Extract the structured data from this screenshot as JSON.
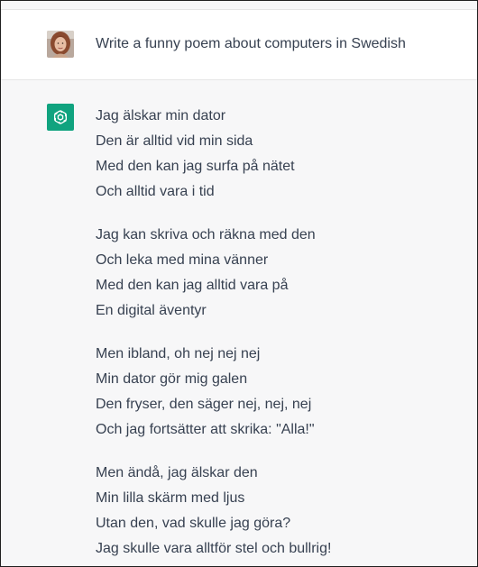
{
  "user": {
    "avatar_icon": "user-avatar-photo",
    "message": "Write a funny poem about computers in Swedish"
  },
  "assistant": {
    "icon": "openai-logo-icon",
    "accent_color": "#10a37f",
    "stanzas": [
      {
        "lines": [
          "Jag älskar min dator",
          "Den är alltid vid min sida",
          "Med den kan jag surfa på nätet",
          "Och alltid vara i tid"
        ]
      },
      {
        "lines": [
          "Jag kan skriva och räkna med den",
          "Och leka med mina vänner",
          "Med den kan jag alltid vara på",
          "En digital äventyr"
        ]
      },
      {
        "lines": [
          "Men ibland, oh nej nej nej",
          "Min dator gör mig galen",
          "Den fryser, den säger nej, nej, nej",
          "Och jag fortsätter att skrika: \"Alla!\""
        ]
      },
      {
        "lines": [
          "Men ändå, jag älskar den",
          "Min lilla skärm med ljus",
          "Utan den, vad skulle jag göra?",
          "Jag skulle vara alltför stel och bullrig!"
        ]
      }
    ]
  }
}
